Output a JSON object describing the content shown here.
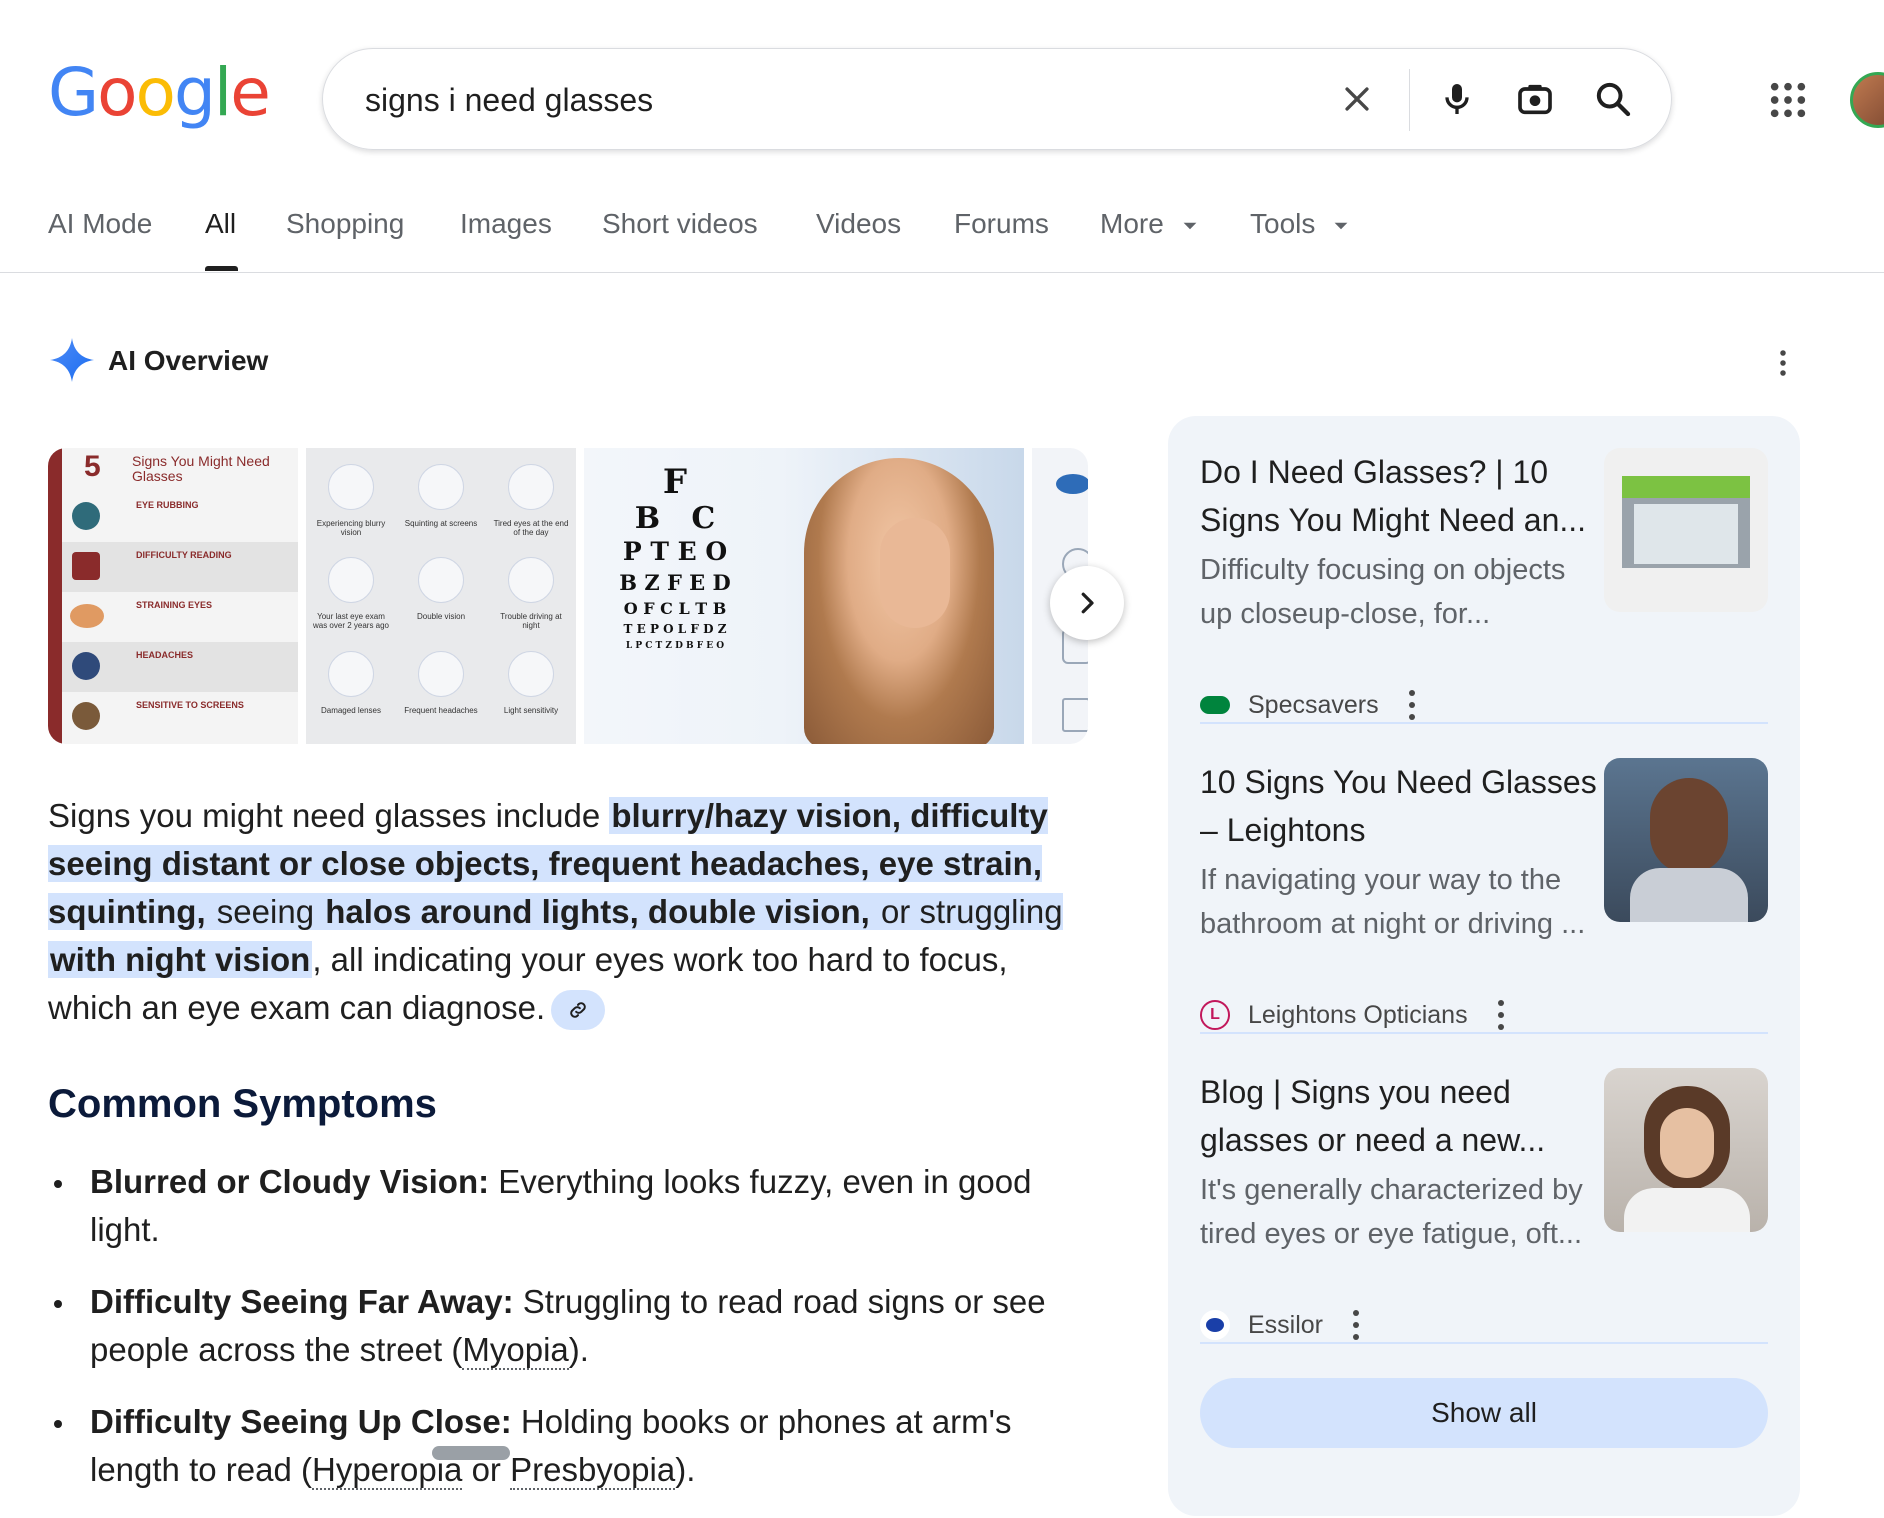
{
  "logo": {
    "letters": [
      "G",
      "o",
      "o",
      "g",
      "l",
      "e"
    ],
    "colors": [
      "#4285F4",
      "#EA4335",
      "#FBBC05",
      "#4285F4",
      "#34A853",
      "#EA4335"
    ]
  },
  "search": {
    "query": "signs i need glasses"
  },
  "tabs": [
    {
      "label": "AI Mode"
    },
    {
      "label": "All"
    },
    {
      "label": "Shopping"
    },
    {
      "label": "Images"
    },
    {
      "label": "Short videos"
    },
    {
      "label": "Videos"
    },
    {
      "label": "Forums"
    },
    {
      "label": "More"
    },
    {
      "label": "Tools"
    }
  ],
  "ai_overview": {
    "title": "AI Overview",
    "images": {
      "img1": {
        "number": "5",
        "heading": "Signs You Might Need Glasses",
        "rows": [
          "EYE RUBBING",
          "DIFFICULTY READING",
          "STRAINING EYES",
          "HEADACHES",
          "SENSITIVE TO SCREENS"
        ]
      },
      "img2": {
        "labels": [
          "Experiencing blurry vision",
          "Squinting at screens",
          "Tired eyes at the end of the day",
          "Your last eye exam was over 2 years ago",
          "Double vision",
          "Trouble driving at night",
          "Damaged lenses",
          "Frequent headaches",
          "Light sensitivity"
        ]
      },
      "img3": {
        "chart_lines": [
          "F",
          "B   C",
          "P T E O",
          "B Z F E D",
          "O F C L T B",
          "T E P O L F D Z",
          "L P C T Z D B F E O"
        ]
      }
    },
    "summary": {
      "p1": "Signs you might need glasses include ",
      "h1": "blurry/hazy vision, difficulty seeing distant or close objects, frequent headaches, eye strain, squinting,",
      "p2": " seeing ",
      "h2": "halos around lights, double vision,",
      "p3": " or struggling ",
      "h3": "with night vision",
      "p4": ", all indicating your eyes work too hard to focus, which an eye exam can diagnose."
    },
    "symptoms_title": "Common Symptoms",
    "symptoms": [
      {
        "term": "Blurred or Cloudy Vision:",
        "text": " Everything looks fuzzy, even in good light."
      },
      {
        "term": "Difficulty Seeing Far Away:",
        "text": " Struggling to read road signs or see people across the street (",
        "link": "Myopia",
        "end": ")."
      },
      {
        "term": "Difficulty Seeing Up Close:",
        "text": " Holding books or phones at arm's length to read (",
        "link": "Hyperopia",
        "mid": " or ",
        "link2": "Presbyopia",
        "end": ")."
      }
    ]
  },
  "sources": [
    {
      "title": "Do I Need Glasses? | 10 Signs You Might Need an...",
      "snippet": "Difficulty focusing on objects up closeup-close, for...",
      "site": "Specsavers"
    },
    {
      "title": "10 Signs You Need Glasses – Leightons",
      "snippet": "If navigating your way to the bathroom at night or driving ...",
      "site": "Leightons Opticians"
    },
    {
      "title": "Blog | Signs you need glasses or need a new...",
      "snippet": "It's generally characterized by tired eyes or eye fatigue, oft...",
      "site": "Essilor"
    }
  ],
  "show_all_label": "Show all"
}
